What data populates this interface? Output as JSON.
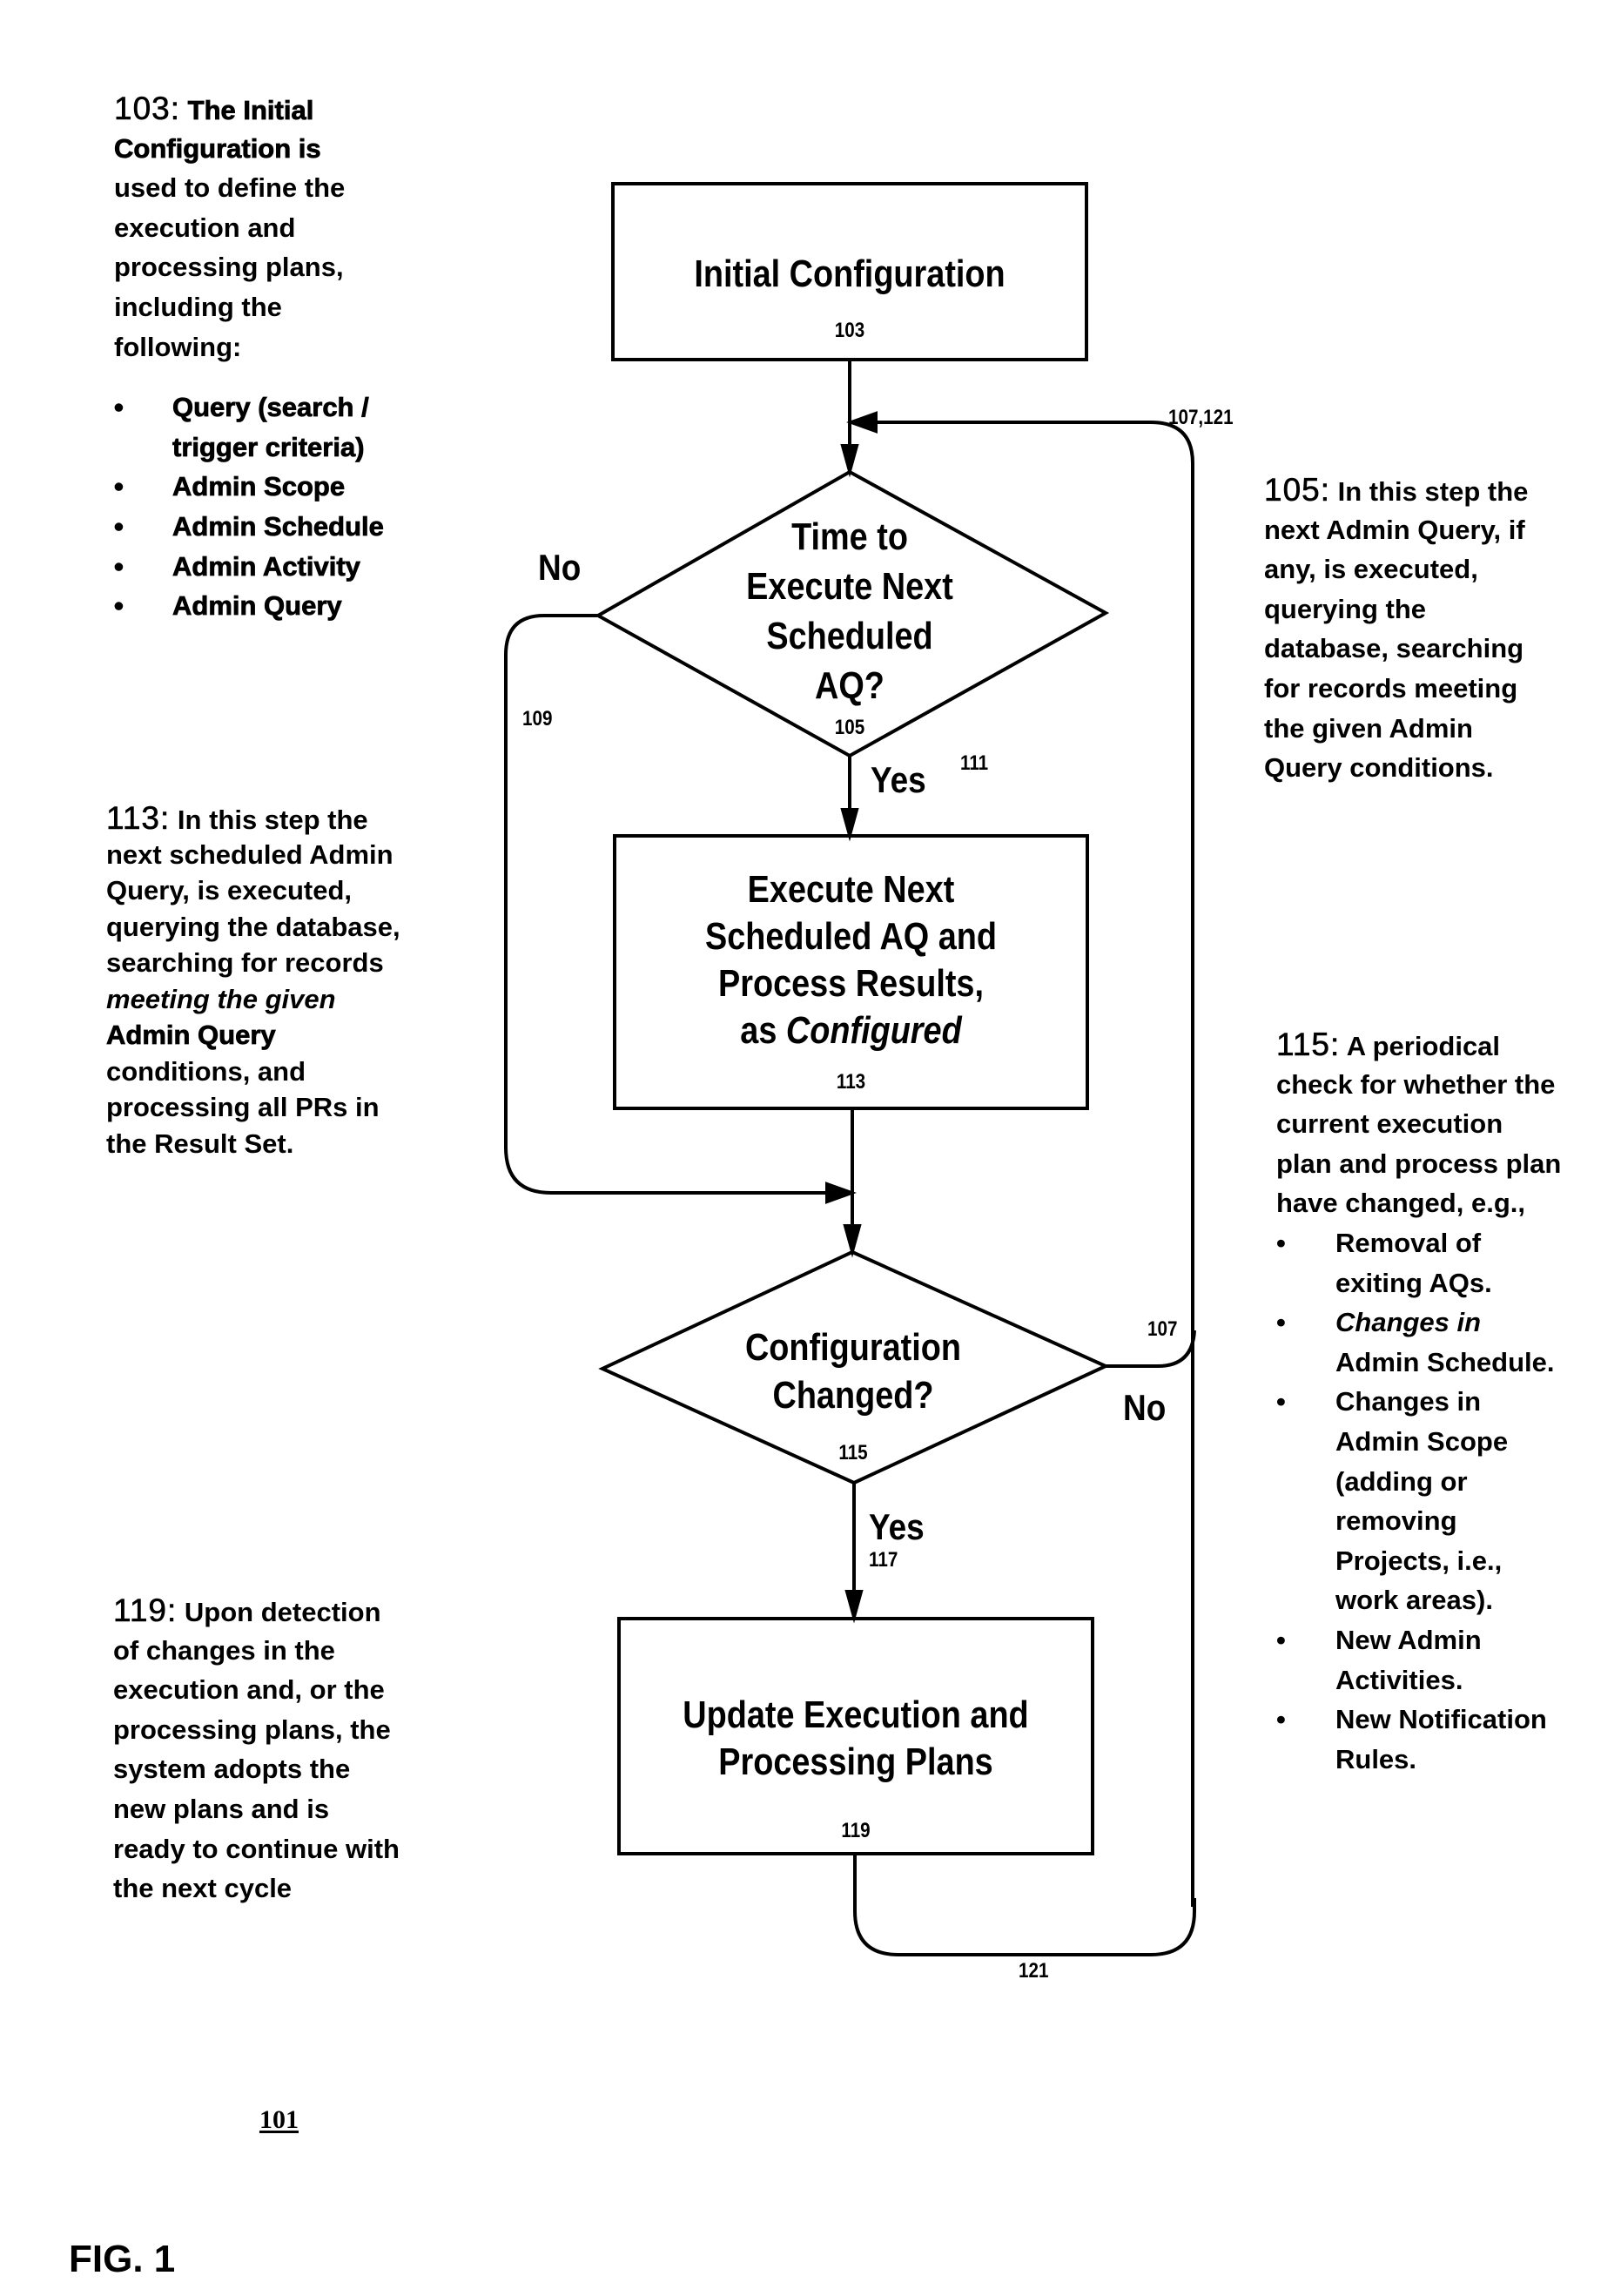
{
  "figure": {
    "label": "FIG. 1",
    "reference": "101"
  },
  "flowchart": {
    "steps": [
      {
        "id": "103",
        "type": "process",
        "lines": [
          "Initial Configuration"
        ],
        "number": "103"
      },
      {
        "id": "105",
        "type": "decision",
        "lines": [
          "Time to",
          "Execute Next",
          "Scheduled",
          "AQ?"
        ],
        "number": "105"
      },
      {
        "id": "113",
        "type": "process",
        "lines": [
          "Execute Next",
          "Scheduled AQ and",
          "Process Results,",
          "as Configured"
        ],
        "number": "113"
      },
      {
        "id": "115",
        "type": "decision",
        "lines": [
          "Configuration",
          "Changed?"
        ],
        "number": "115"
      },
      {
        "id": "119",
        "type": "process",
        "lines": [
          "Update Execution and",
          "Processing Plans"
        ],
        "number": "119"
      }
    ],
    "edges": [
      {
        "from": "103",
        "to": "105",
        "label": ""
      },
      {
        "from": "105",
        "to": "113",
        "label": "Yes",
        "number": "111"
      },
      {
        "from": "105",
        "to": "115",
        "label": "No",
        "number": "109"
      },
      {
        "from": "113",
        "to": "115",
        "label": ""
      },
      {
        "from": "115",
        "to": "105",
        "label": "No",
        "number": "107"
      },
      {
        "from": "115",
        "to": "119",
        "label": "Yes",
        "number": "117"
      },
      {
        "from": "119",
        "to": "105",
        "label": "",
        "number": "121"
      }
    ],
    "loop_label": "107,121"
  },
  "notes": {
    "n103": {
      "ref": "103:",
      "lines": [
        "The Initial",
        "Configuration is",
        "used to define the",
        "execution and",
        "processing plans,",
        "including the",
        "following:"
      ],
      "bullets": [
        [
          "Query (search /",
          "trigger criteria)"
        ],
        [
          "Admin Scope"
        ],
        [
          "Admin Schedule"
        ],
        [
          "Admin Activity"
        ],
        [
          "Admin Query"
        ]
      ]
    },
    "n105": {
      "ref": "105:",
      "lines": [
        "In this step the",
        "next Admin Query, if",
        "any, is executed,",
        "querying the",
        "database, searching",
        "for records meeting",
        "the given Admin",
        "Query conditions."
      ]
    },
    "n113": {
      "ref": "113:",
      "lines": [
        "In this step the",
        "next scheduled Admin",
        "Query, is executed,",
        "querying the database,",
        "searching for records",
        "meeting the given",
        "Admin Query",
        "conditions, and",
        "processing all PRs in",
        "the Result Set."
      ]
    },
    "n115": {
      "ref": "115:",
      "lines": [
        "A periodical",
        "check for whether the",
        "current execution",
        "plan and process plan",
        "have changed, e.g.,"
      ],
      "bullets": [
        [
          "Removal of",
          "exiting AQs."
        ],
        [
          "Changes in",
          "Admin Schedule."
        ],
        [
          "Changes in",
          "Admin Scope",
          "(adding or",
          "removing",
          "Projects, i.e.,",
          "work areas)."
        ],
        [
          "New Admin",
          "Activities."
        ],
        [
          "New Notification",
          "Rules."
        ]
      ]
    },
    "n119": {
      "ref": "119:",
      "lines": [
        "Upon detection",
        "of changes in the",
        "execution and, or the",
        "processing plans, the",
        "system adopts the",
        "new plans and is",
        "ready to continue with",
        "the next cycle"
      ]
    }
  },
  "bullet_glyph": "•",
  "colors": {
    "ink": "#000000",
    "paper": "#ffffff"
  }
}
